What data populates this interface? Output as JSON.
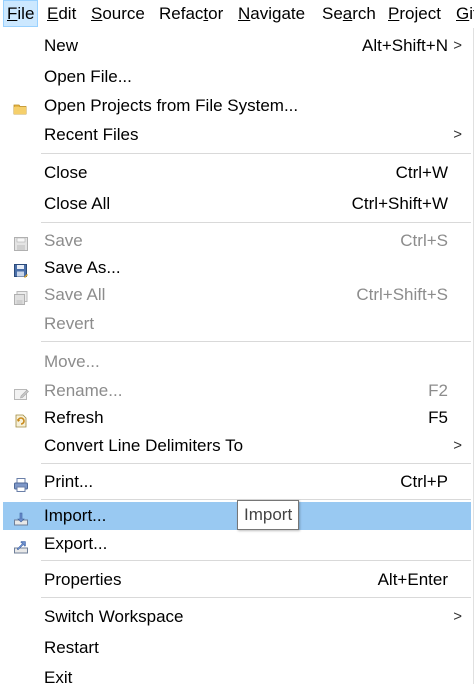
{
  "menubar": {
    "items": [
      {
        "label": "File",
        "mnemonic": "F",
        "rest": "ile",
        "active": true
      },
      {
        "label": "Edit",
        "mnemonic": "E",
        "rest": "dit"
      },
      {
        "label": "Source",
        "mnemonic": "S",
        "rest": "ource"
      },
      {
        "label": "Refactor",
        "pre": "Refac",
        "mnemonic": "t",
        "rest": "or"
      },
      {
        "label": "Navigate",
        "mnemonic": "N",
        "rest": "avigate"
      },
      {
        "label": "Search",
        "pre": "Se",
        "mnemonic": "a",
        "rest": "rch"
      },
      {
        "label": "Project",
        "mnemonic": "P",
        "rest": "roject"
      },
      {
        "label": "Git",
        "mnemonic": "G",
        "rest": "it"
      }
    ]
  },
  "file_menu": {
    "new": {
      "label": "New",
      "shortcut": "Alt+Shift+N",
      "submenu": ">"
    },
    "open_file": {
      "label": "Open File..."
    },
    "open_projects": {
      "label": "Open Projects from File System...",
      "icon": "folder-icon"
    },
    "recent_files": {
      "label": "Recent Files",
      "submenu": ">"
    },
    "close": {
      "label": "Close",
      "shortcut": "Ctrl+W"
    },
    "close_all": {
      "label": "Close All",
      "shortcut": "Ctrl+Shift+W"
    },
    "save": {
      "label": "Save",
      "shortcut": "Ctrl+S",
      "disabled": true,
      "icon": "save-icon"
    },
    "save_as": {
      "label": "Save As...",
      "icon": "save-as-icon"
    },
    "save_all": {
      "label": "Save All",
      "shortcut": "Ctrl+Shift+S",
      "disabled": true,
      "icon": "save-all-icon"
    },
    "revert": {
      "label": "Revert",
      "disabled": true
    },
    "move": {
      "label": "Move...",
      "disabled": true
    },
    "rename": {
      "label": "Rename...",
      "shortcut": "F2",
      "disabled": true,
      "icon": "rename-icon"
    },
    "refresh": {
      "label": "Refresh",
      "shortcut": "F5",
      "icon": "refresh-icon"
    },
    "convert_line_delimiters": {
      "label": "Convert Line Delimiters To",
      "submenu": ">"
    },
    "print": {
      "label": "Print...",
      "shortcut": "Ctrl+P",
      "icon": "print-icon"
    },
    "import": {
      "label": "Import...",
      "highlighted": true,
      "icon": "import-icon"
    },
    "export": {
      "label": "Export...",
      "icon": "export-icon"
    },
    "properties": {
      "label": "Properties",
      "shortcut": "Alt+Enter"
    },
    "switch_workspace": {
      "label": "Switch Workspace",
      "submenu": ">"
    },
    "restart": {
      "label": "Restart"
    },
    "exit": {
      "label": "Exit"
    }
  },
  "tooltip": {
    "text": "Import"
  },
  "colors": {
    "highlight": "#99c9f2",
    "active_menubar": "#cce8ff",
    "disabled_text": "#8c8c8c",
    "separator": "#d9d9d9"
  }
}
